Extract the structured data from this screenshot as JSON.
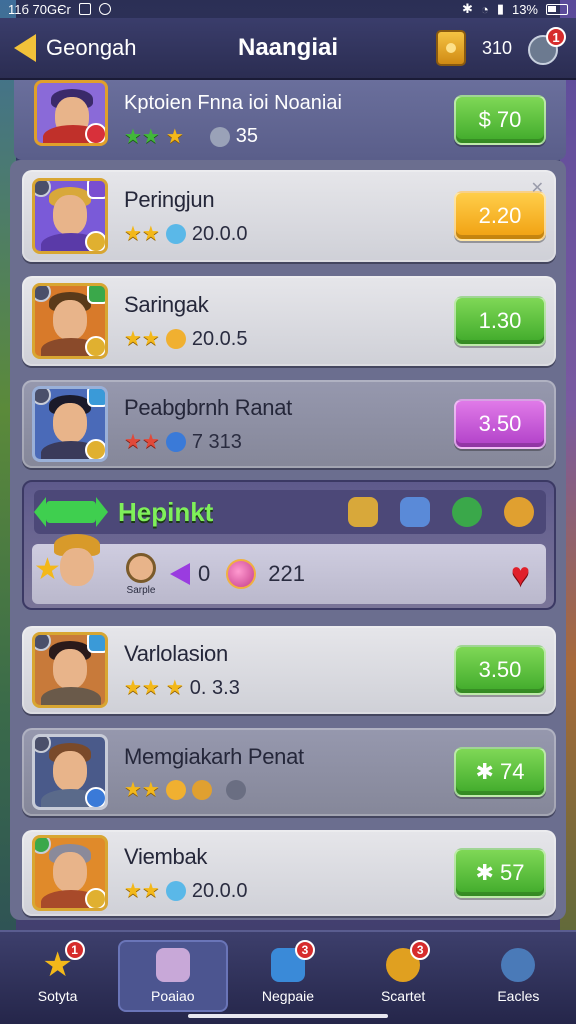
{
  "status_bar": {
    "time": "11б 70GЄr",
    "battery": "13%"
  },
  "header": {
    "back_label": "Geongah",
    "title": "Naangiai",
    "coins": "310",
    "notif_count": "1"
  },
  "top_item": {
    "name": "Kptoien Fnna ioi Noaniai",
    "stat": "35",
    "price": "$ 70"
  },
  "items": [
    {
      "name": "Peringjun",
      "stat": "20.0.0",
      "price": "2.20",
      "style": "orange"
    },
    {
      "name": "Saringak",
      "stat": "20.0.5",
      "price": "1.30",
      "style": "green"
    },
    {
      "name": "Peabgbrnh Ranat",
      "stat": "7  313",
      "price": "3.50",
      "style": "purple"
    },
    {
      "name": "Varlolasion",
      "stat": "0.  3.3",
      "price": "3.50",
      "style": "green"
    },
    {
      "name": "Memgiakarh Penat",
      "stat": "",
      "price": "✱ 74",
      "style": "green"
    },
    {
      "name": "Viembak",
      "stat": "20.0.0",
      "price": "✱ 57",
      "style": "green"
    }
  ],
  "featured": {
    "title": "Hepinkt",
    "profile_label": "Sarple",
    "count_a": "0",
    "count_b": "221"
  },
  "nav": [
    {
      "label": "Sotyta",
      "badge": "1"
    },
    {
      "label": "Poaiao",
      "badge": ""
    },
    {
      "label": "Negpaie",
      "badge": "3"
    },
    {
      "label": "Scartet",
      "badge": "3"
    },
    {
      "label": "Eacles",
      "badge": ""
    }
  ],
  "colors": {
    "accent_green": "#3fa92a",
    "accent_orange": "#f0a010",
    "accent_purple": "#b040c8",
    "badge_red": "#d62c2c"
  }
}
